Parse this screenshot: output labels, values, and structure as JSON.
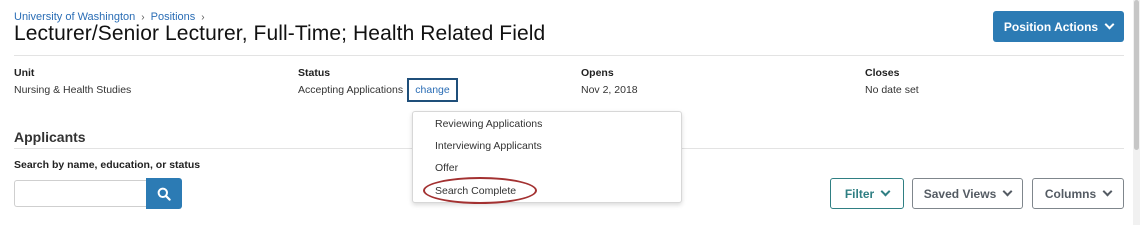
{
  "breadcrumb": {
    "items": [
      "University of Washington",
      "Positions"
    ],
    "separator": "›"
  },
  "page": {
    "title": "Lecturer/Senior Lecturer, Full-Time; Health Related Field",
    "actions_label": "Position Actions"
  },
  "meta": {
    "unit": {
      "label": "Unit",
      "value": "Nursing & Health Studies"
    },
    "status": {
      "label": "Status",
      "value": "Accepting Applications",
      "change_label": "change"
    },
    "opens": {
      "label": "Opens",
      "value": "Nov 2, 2018"
    },
    "closes": {
      "label": "Closes",
      "value": "No date set"
    }
  },
  "applicants": {
    "section_title": "Applicants",
    "search_label": "Search by name, education, or status",
    "search_value": "",
    "search_placeholder": ""
  },
  "status_menu": {
    "items": [
      "Reviewing Applications",
      "Interviewing Applicants",
      "Offer",
      "Search Complete"
    ],
    "highlighted": "Search Complete"
  },
  "toolbar": {
    "filter_label": "Filter",
    "saved_views_label": "Saved Views",
    "columns_label": "Columns"
  },
  "icons": {
    "search": "search-icon",
    "chevron": "chevron-down-icon"
  },
  "colors": {
    "primary": "#2c7bb4",
    "link": "#2a6db5",
    "filter_accent": "#2f7f83",
    "highlight_ring": "#a33131",
    "change_border": "#1f4f7a"
  }
}
